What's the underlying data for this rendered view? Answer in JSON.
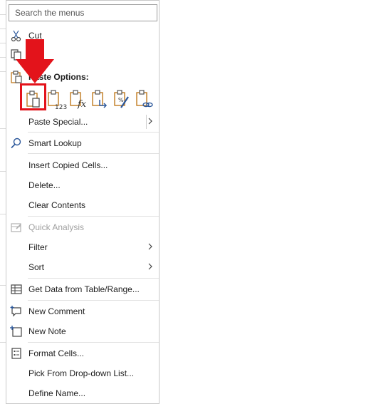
{
  "menu": {
    "search": {
      "placeholder": "Search the menus"
    },
    "items": {
      "cut": "Cut",
      "paste_options": "Paste Options:",
      "paste_special": "Paste Special...",
      "smart_lookup": "Smart Lookup",
      "insert_copied_cells": "Insert Copied Cells...",
      "delete": "Delete...",
      "clear_contents": "Clear Contents",
      "quick_analysis": "Quick Analysis",
      "filter": "Filter",
      "sort": "Sort",
      "get_data": "Get Data from Table/Range...",
      "new_comment": "New Comment",
      "new_note": "New Note",
      "format_cells": "Format Cells...",
      "pick_from_dropdown": "Pick From Drop-down List...",
      "define_name": "Define Name..."
    },
    "paste_buttons": [
      {
        "icon": "paste-icon"
      },
      {
        "icon": "paste-values-icon"
      },
      {
        "icon": "paste-formulas-icon"
      },
      {
        "icon": "paste-transpose-icon"
      },
      {
        "icon": "paste-formatting-icon"
      },
      {
        "icon": "paste-link-icon"
      }
    ]
  },
  "colors": {
    "highlight": "#e3131b",
    "accent_blue": "#2b579a",
    "clipboard_orange": "#c07a1f"
  }
}
